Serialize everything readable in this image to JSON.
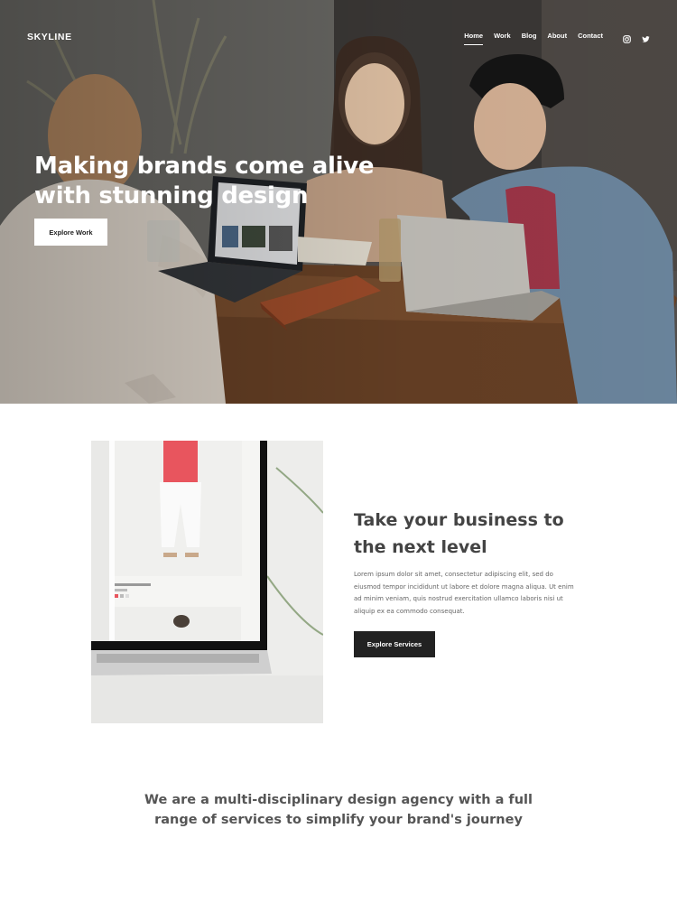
{
  "header": {
    "brand": "SKYLINE",
    "nav": [
      {
        "label": "Home",
        "active": true
      },
      {
        "label": "Work",
        "active": false
      },
      {
        "label": "Blog",
        "active": false
      },
      {
        "label": "About",
        "active": false
      },
      {
        "label": "Contact",
        "active": false
      }
    ],
    "social": [
      "instagram-icon",
      "twitter-icon"
    ]
  },
  "hero": {
    "title": "Making brands come alive with stunning design",
    "button_label": "Explore Work"
  },
  "feature": {
    "heading": "Take your business to the next level",
    "body": "Lorem ipsum dolor sit amet, consectetur adipiscing elit, sed do eiusmod tempor incididunt ut labore et dolore magna aliqua. Ut enim ad minim veniam, quis nostrud exercitation ullamco laboris nisi ut aliquip ex ea commodo consequat.",
    "button_label": "Explore Services"
  },
  "about": {
    "text": "We are a multi-disciplinary design agency with a full range of services to simplify your brand's journey"
  },
  "colors": {
    "dark_button": "#222222",
    "heading": "#444444",
    "body_text": "#666666"
  }
}
